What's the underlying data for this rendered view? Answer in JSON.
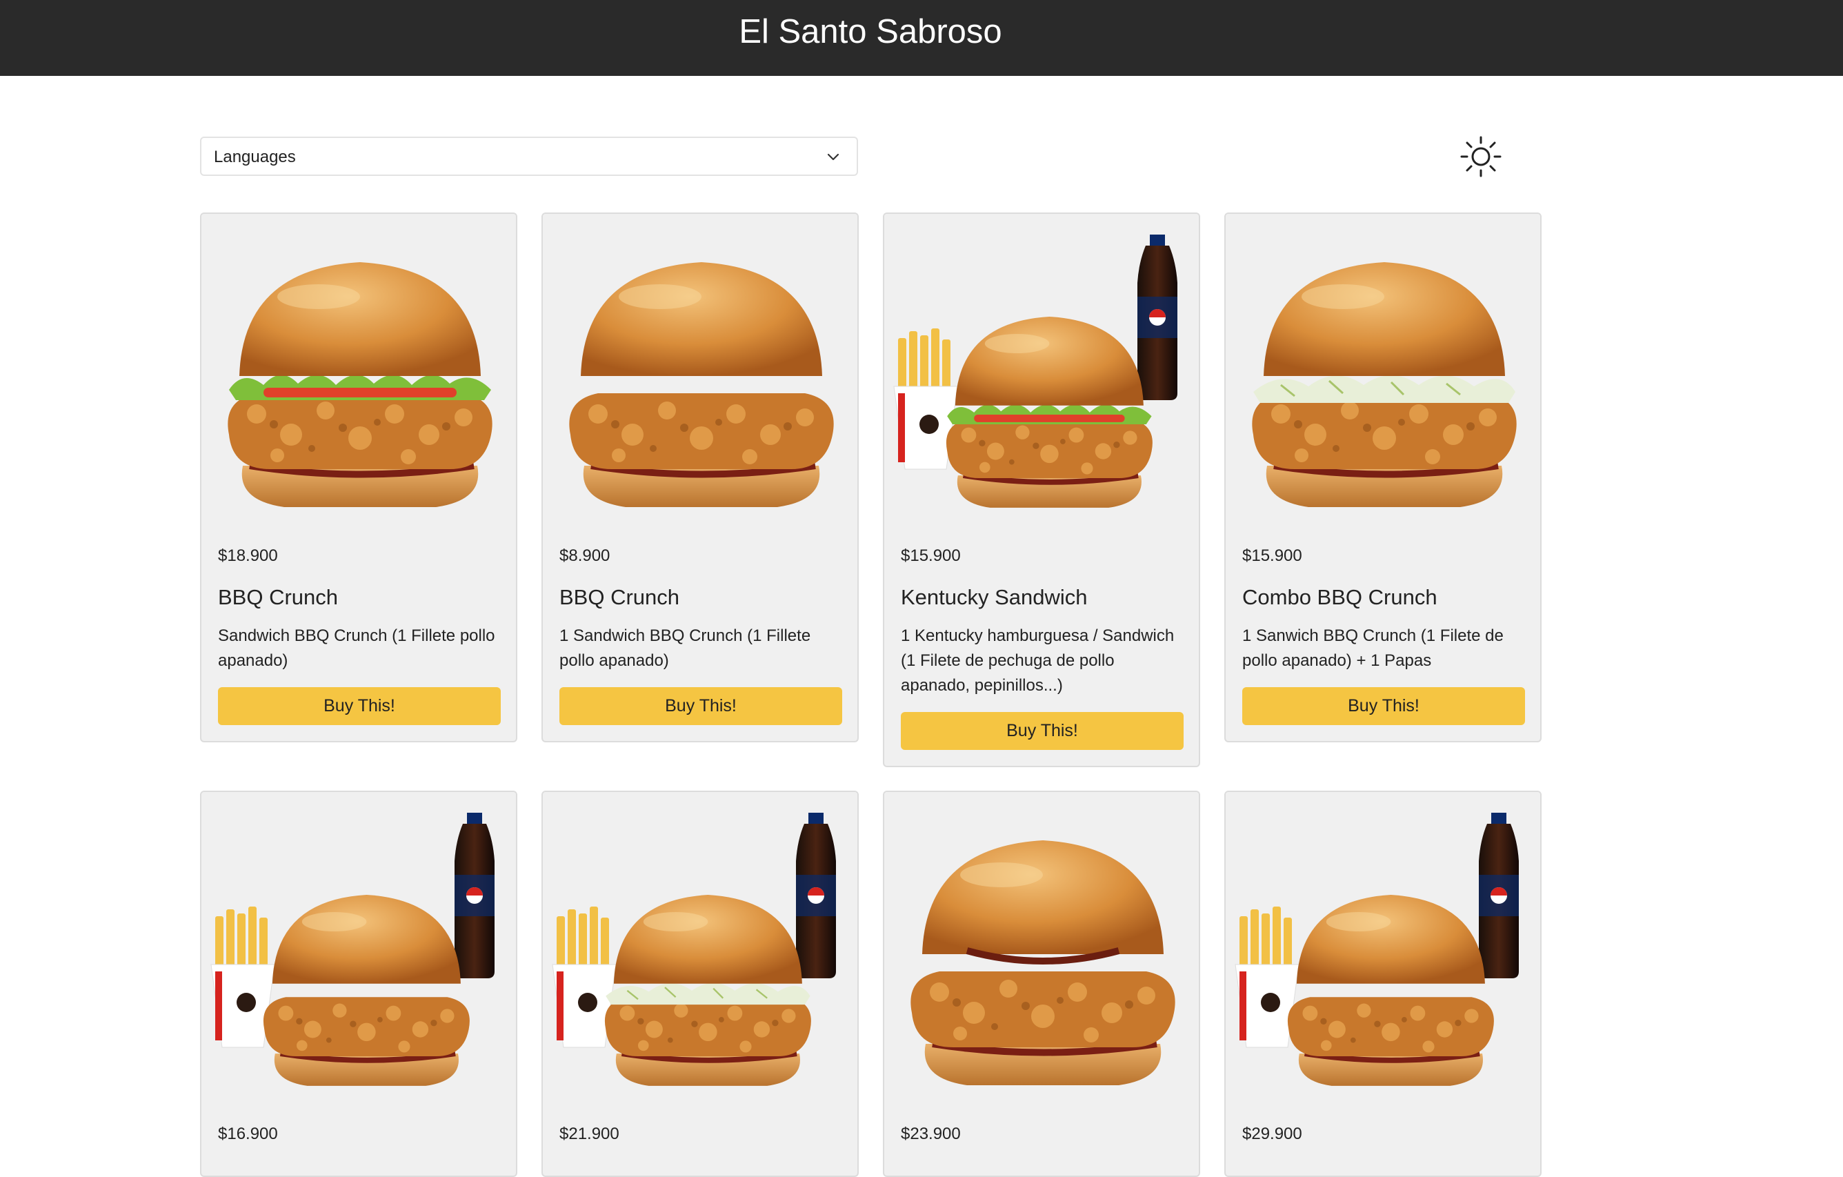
{
  "header": {
    "title": "El Santo Sabroso"
  },
  "controls": {
    "language_select": "Languages",
    "theme_icon": "sun-icon"
  },
  "colors": {
    "topbar": "#2a2a2a",
    "button": "#f5c542",
    "card_bg": "#f0f0f0"
  },
  "products": [
    {
      "price": "$18.900",
      "name": "BBQ Crunch",
      "description": "Sandwich BBQ Crunch (1 Fillete pollo apanado)",
      "button": "Buy This!",
      "image": "burger-lettuce"
    },
    {
      "price": "$8.900",
      "name": "BBQ Crunch",
      "description": "1 Sandwich BBQ Crunch (1 Fillete pollo apanado)",
      "button": "Buy This!",
      "image": "burger-pickles"
    },
    {
      "price": "$15.900",
      "name": "Kentucky Sandwich",
      "description": "1 Kentucky hamburguesa / Sandwich (1 Filete de pechuga de pollo apanado, pepinillos...)",
      "button": "Buy This!",
      "image": "combo-lettuce"
    },
    {
      "price": "$15.900",
      "name": "Combo BBQ Crunch",
      "description": "1 Sanwich BBQ Crunch (1 Filete de pollo apanado) + 1 Papas",
      "button": "Buy This!",
      "image": "burger-slaw"
    },
    {
      "price": "$16.900",
      "image": "combo-pickles"
    },
    {
      "price": "$21.900",
      "image": "combo-slaw"
    },
    {
      "price": "$23.900",
      "image": "burger-cheese"
    },
    {
      "price": "$29.900",
      "image": "combo-cheese"
    }
  ]
}
